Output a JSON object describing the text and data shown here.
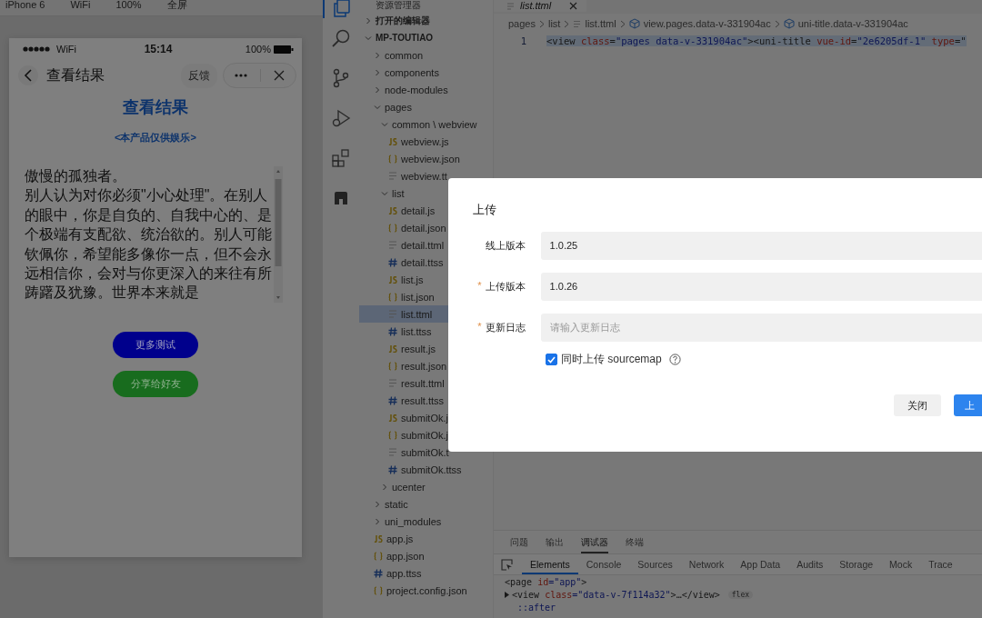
{
  "simulator": {
    "toolbar": [
      "iPhone 6",
      "WiFi",
      "100%",
      "全屏"
    ],
    "phone": {
      "status": {
        "network": "WiFi",
        "time": "15:14",
        "battery": "100%"
      },
      "nav": {
        "title": "查看结果",
        "feedback": "反馈"
      },
      "heading": "查看结果",
      "subtitle": "<本产品仅供娱乐>",
      "result_title": "傲慢的孤独者。",
      "result_text": "别人认为对你必须\"小心处理\"。在别人的眼中，你是自负的、自我中心的、是个极端有支配欲、统治欲的。别人可能钦佩你，希望能多像你一点，但不会永远相信你，会对与你更深入的来往有所踌躇及犹豫。世界本来就是",
      "buttons": [
        {
          "label": "更多测试",
          "color": "#00008c"
        },
        {
          "label": "分享给好友",
          "color": "#186c1e"
        }
      ]
    }
  },
  "activity_bar": [
    {
      "kind": "files",
      "selected": true
    },
    {
      "kind": "search",
      "selected": false
    },
    {
      "kind": "branch",
      "selected": false
    },
    {
      "kind": "debug",
      "selected": false
    },
    {
      "kind": "extensions",
      "selected": false
    },
    {
      "kind": "block",
      "selected": false
    }
  ],
  "explorer": {
    "title": "资源管理器",
    "sections": [
      {
        "label": "打开的编辑器",
        "expanded": false
      },
      {
        "label": "MP-TOUTIAO",
        "expanded": true
      }
    ],
    "tree": [
      {
        "label": "common",
        "kind": "folder",
        "expanded": false,
        "selected": false
      },
      {
        "label": "components",
        "kind": "folder",
        "expanded": false,
        "selected": false
      },
      {
        "label": "node-modules",
        "kind": "folder",
        "expanded": false,
        "selected": false
      },
      {
        "label": "pages",
        "kind": "folder",
        "expanded": true,
        "selected": false,
        "children": [
          {
            "label": "common \\ webview",
            "kind": "folder",
            "expanded": true,
            "selected": false,
            "children": [
              {
                "label": "webview.js",
                "kind": "js",
                "selected": false
              },
              {
                "label": "webview.json",
                "kind": "json",
                "selected": false
              },
              {
                "label": "webview.tt",
                "kind": "ttml",
                "selected": false
              }
            ]
          },
          {
            "label": "list",
            "kind": "folder",
            "expanded": true,
            "selected": false,
            "children": [
              {
                "label": "detail.js",
                "kind": "js",
                "selected": false
              },
              {
                "label": "detail.json",
                "kind": "json",
                "selected": false
              },
              {
                "label": "detail.ttml",
                "kind": "ttml",
                "selected": false
              },
              {
                "label": "detail.ttss",
                "kind": "ttss",
                "selected": false
              },
              {
                "label": "list.js",
                "kind": "js",
                "selected": false
              },
              {
                "label": "list.json",
                "kind": "json",
                "selected": false
              },
              {
                "label": "list.ttml",
                "kind": "ttml",
                "selected": true
              },
              {
                "label": "list.ttss",
                "kind": "ttss",
                "selected": false
              },
              {
                "label": "result.js",
                "kind": "js",
                "selected": false
              },
              {
                "label": "result.json",
                "kind": "json",
                "selected": false
              },
              {
                "label": "result.ttml",
                "kind": "ttml",
                "selected": false
              },
              {
                "label": "result.ttss",
                "kind": "ttss",
                "selected": false
              },
              {
                "label": "submitOk.j",
                "kind": "js",
                "selected": false
              },
              {
                "label": "submitOk.j",
                "kind": "json",
                "selected": false
              },
              {
                "label": "submitOk.t",
                "kind": "ttml",
                "selected": false
              },
              {
                "label": "submitOk.ttss",
                "kind": "ttss",
                "selected": false
              }
            ]
          },
          {
            "label": "ucenter",
            "kind": "folder",
            "expanded": false,
            "selected": false
          }
        ]
      },
      {
        "label": "static",
        "kind": "folder",
        "expanded": false,
        "selected": false
      },
      {
        "label": "uni_modules",
        "kind": "folder",
        "expanded": false,
        "selected": false
      },
      {
        "label": "app.js",
        "kind": "js",
        "selected": false
      },
      {
        "label": "app.json",
        "kind": "json",
        "selected": false
      },
      {
        "label": "app.ttss",
        "kind": "ttss",
        "selected": false
      },
      {
        "label": "project.config.json",
        "kind": "json",
        "selected": false
      }
    ]
  },
  "editor": {
    "tab": "list.ttml",
    "breadcrumb": [
      {
        "label": "pages",
        "kind": "text"
      },
      {
        "label": "list",
        "kind": "text"
      },
      {
        "label": "list.ttml",
        "kind": "file"
      },
      {
        "label": "view.pages.data-v-331904ac",
        "kind": "element"
      },
      {
        "label": "uni-title.data-v-331904ac",
        "kind": "element"
      }
    ],
    "lines": [
      {
        "number": "1",
        "tokens": [
          {
            "text": "<view ",
            "kind": "tag"
          },
          {
            "text": "class",
            "kind": "attr"
          },
          {
            "text": "=",
            "kind": "punct"
          },
          {
            "text": "\"pages data-v-331904ac\"",
            "kind": "value"
          },
          {
            "text": ">",
            "kind": "tag"
          },
          {
            "text": "<uni-title ",
            "kind": "tag"
          },
          {
            "text": "vue-id",
            "kind": "attr"
          },
          {
            "text": "=",
            "kind": "punct"
          },
          {
            "text": "\"2e6205df-1\" ",
            "kind": "value"
          },
          {
            "text": "type",
            "kind": "attr"
          },
          {
            "text": "=\"",
            "kind": "punct"
          }
        ]
      }
    ]
  },
  "panel": {
    "tabs": [
      {
        "label": "问题",
        "selected": false
      },
      {
        "label": "输出",
        "selected": false
      },
      {
        "label": "调试器",
        "selected": true
      },
      {
        "label": "终端",
        "selected": false
      }
    ],
    "devtools_tabs": [
      {
        "label": "Elements",
        "selected": true
      },
      {
        "label": "Console",
        "selected": false
      },
      {
        "label": "Sources",
        "selected": false
      },
      {
        "label": "Network",
        "selected": false
      },
      {
        "label": "App Data",
        "selected": false
      },
      {
        "label": "Audits",
        "selected": false
      },
      {
        "label": "Storage",
        "selected": false
      },
      {
        "label": "Mock",
        "selected": false
      },
      {
        "label": "Trace",
        "selected": false
      }
    ],
    "elements": [
      {
        "kind": "plain",
        "tokens": [
          {
            "text": "<page ",
            "kind": "tag"
          },
          {
            "text": "id",
            "kind": "attr"
          },
          {
            "text": "=\"app\"",
            "kind": "value"
          },
          {
            "text": ">",
            "kind": "tag"
          }
        ]
      },
      {
        "kind": "collapsed",
        "badge": "flex",
        "tokens": [
          {
            "text": "<view ",
            "kind": "tag"
          },
          {
            "text": "class",
            "kind": "attr"
          },
          {
            "text": "=\"data-v-7f114a32\"",
            "kind": "value"
          },
          {
            "text": ">…</view>",
            "kind": "tag"
          }
        ]
      },
      {
        "kind": "pseudo",
        "tokens": [
          {
            "text": "::after",
            "kind": "value"
          }
        ]
      }
    ]
  },
  "dialog": {
    "title": "上传",
    "required_mark": "*",
    "fields": [
      {
        "label": "线上版本",
        "required": false,
        "value": "1.0.25"
      },
      {
        "label": "上传版本",
        "required": true,
        "value": "1.0.26"
      },
      {
        "label": "更新日志",
        "required": true,
        "placeholder": "请输入更新日志"
      }
    ],
    "sourcemap": {
      "label": "同时上传 sourcemap",
      "checked": true
    },
    "buttons": [
      {
        "label": "关闭",
        "kind": "secondary"
      },
      {
        "label": "上",
        "kind": "primary"
      }
    ]
  }
}
